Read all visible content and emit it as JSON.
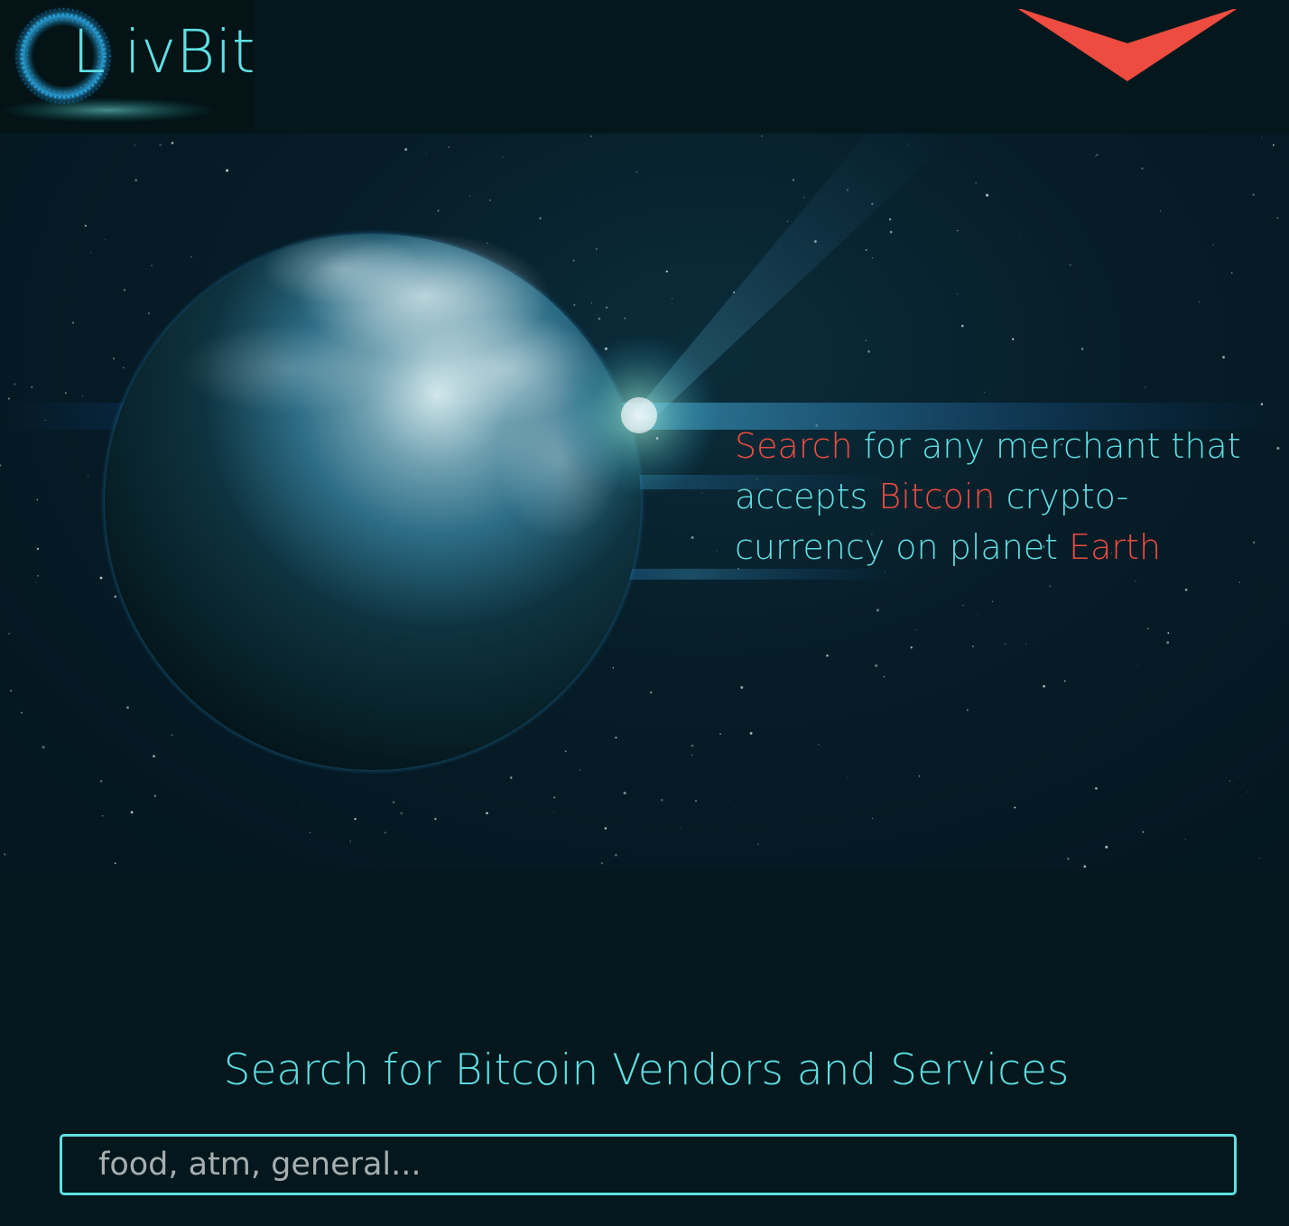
{
  "header": {
    "logo_text": "L ivBit",
    "menu_icon": "chevron-down-icon",
    "menu_icon_color": "#ee4c41"
  },
  "hero": {
    "tagline": {
      "seg1": "Search",
      "seg2": " for any merchant that accepts ",
      "seg3": "Bitcoin",
      "seg4": " crypto-currency on planet ",
      "seg5": "Earth"
    }
  },
  "search": {
    "title": "Search for Bitcoin Vendors and Services",
    "placeholder": "food, atm, general..."
  },
  "colors": {
    "primary_text": "#5ee0e3",
    "accent": "#ee4c41",
    "background": "#04171c"
  }
}
